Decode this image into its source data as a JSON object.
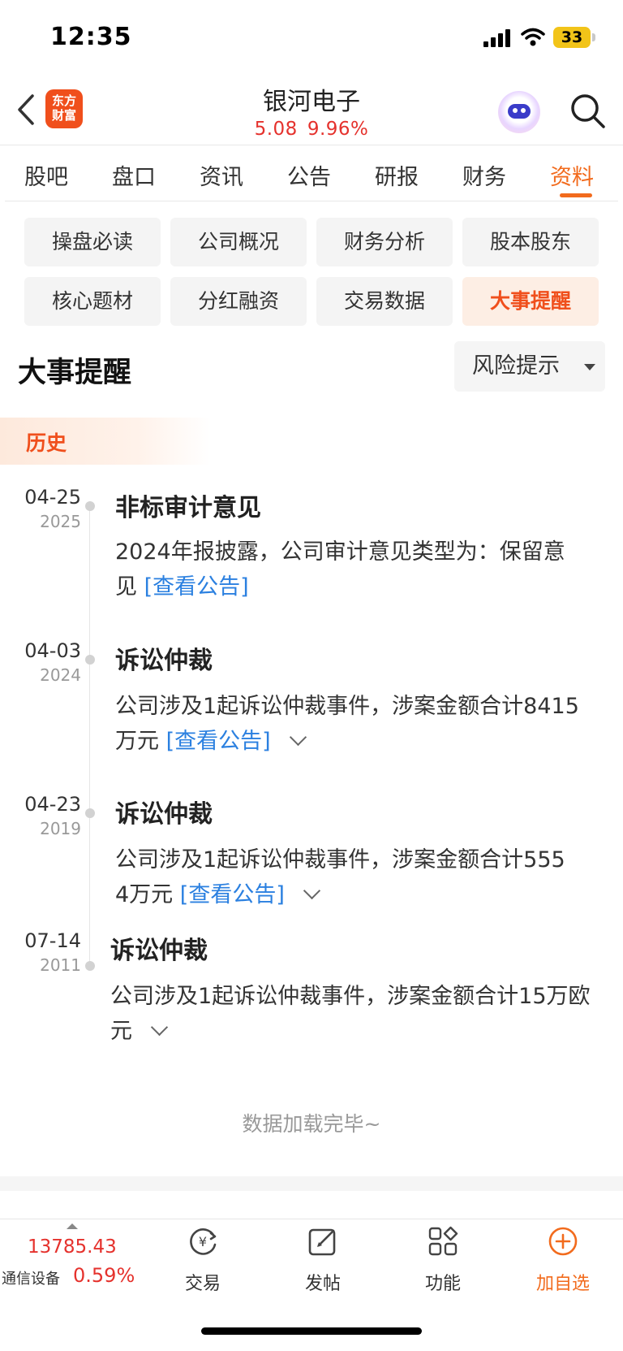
{
  "status_bar": {
    "time": "12:35",
    "battery": "33"
  },
  "header": {
    "logo_text": [
      "东方",
      "财富"
    ],
    "stock_name": "银河电子",
    "price": "5.08",
    "change_pct": "9.96%",
    "accent_color": "#f26b1d",
    "up_color": "#e5322d"
  },
  "tabs": [
    "股吧",
    "盘口",
    "资讯",
    "公告",
    "研报",
    "财务",
    "资料"
  ],
  "active_tab": "资料",
  "chips": [
    "操盘必读",
    "公司概况",
    "财务分析",
    "股本股东",
    "核心题材",
    "分红融资",
    "交易数据",
    "大事提醒"
  ],
  "active_chip": "大事提醒",
  "section": {
    "title": "大事提醒",
    "filter_label": "风险提示",
    "history_label": "历史"
  },
  "events": [
    {
      "date": "04-25",
      "year": "2025",
      "title": "非标审计意见",
      "body_l1": "2024年报披露，公司审计意见类型为：保留意",
      "body_l2": "见",
      "link": "[查看公告]",
      "expand": false
    },
    {
      "date": "04-03",
      "year": "2024",
      "title": "诉讼仲裁",
      "body_l1": "公司涉及1起诉讼仲裁事件，涉案金额合计8415",
      "body_l2": "万元",
      "link": "[查看公告]",
      "expand": true
    },
    {
      "date": "04-23",
      "year": "2019",
      "title": "诉讼仲裁",
      "body_l1": "公司涉及1起诉讼仲裁事件，涉案金额合计555",
      "body_l2": "4万元",
      "link": "[查看公告]",
      "expand": true
    },
    {
      "date": "07-14",
      "year": "2011",
      "title": "诉讼仲裁",
      "body_l1": "公司涉及1起诉讼仲裁事件，涉案金额合计15万欧",
      "body_l2": "元",
      "link": "",
      "expand": true
    }
  ],
  "footer_text": "数据加载完毕~",
  "bottom_bar": {
    "index_value": "13785.43",
    "index_name": "通信设备",
    "index_pct": "0.59%",
    "items": [
      {
        "label": "交易",
        "icon": "trade-icon"
      },
      {
        "label": "发帖",
        "icon": "compose-icon"
      },
      {
        "label": "功能",
        "icon": "apps-icon"
      },
      {
        "label": "加自选",
        "icon": "add-watchlist-icon"
      }
    ]
  }
}
